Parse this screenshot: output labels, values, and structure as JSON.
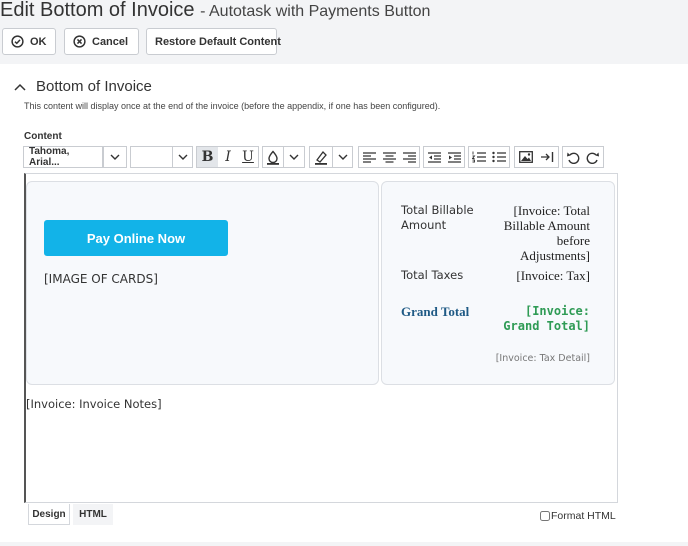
{
  "header": {
    "title": "Edit Bottom of Invoice",
    "subtitle": "- Autotask with Payments Button"
  },
  "toolbar": {
    "ok_label": "OK",
    "cancel_label": "Cancel",
    "restore_label": "Restore Default Content"
  },
  "section": {
    "title": "Bottom of Invoice",
    "description": "This content will display once at the end of the invoice (before the appendix, if one has been configured).",
    "content_label": "Content"
  },
  "editor_toolbar": {
    "font_family": "Tahoma, Arial...",
    "font_size": "",
    "bold": "B",
    "italic": "I",
    "underline": "U"
  },
  "document": {
    "pay_button": "Pay Online Now",
    "cards_placeholder": "[IMAGE OF CARDS]",
    "totals": [
      {
        "label": "Total Billable Amount",
        "value": "[Invoice: Total Billable Amount before Adjustments]"
      },
      {
        "label": "Total Taxes",
        "value": "[Invoice: Tax]"
      }
    ],
    "grand_total_label": "Grand Total",
    "grand_total_value": "[Invoice: Grand Total]",
    "tax_detail": "[Invoice: Tax Detail]",
    "notes": "[Invoice: Invoice Notes]"
  },
  "tabs": [
    "Design",
    "HTML"
  ],
  "format_html_label": "Format HTML",
  "colors": {
    "pay_button": "#12b3e8",
    "grand_total_label": "#1f5a85",
    "grand_total_value": "#2f9b55"
  }
}
